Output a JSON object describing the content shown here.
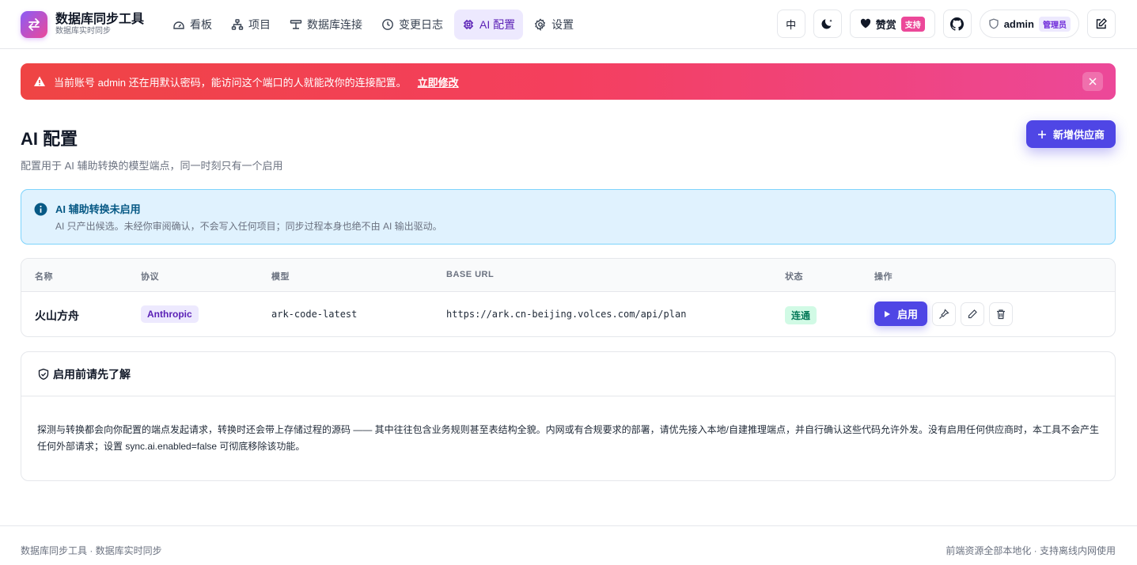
{
  "brand": {
    "title": "数据库同步工具",
    "subtitle": "数据库实时同步"
  },
  "nav": [
    {
      "label": "看板",
      "icon": "dashboard-icon"
    },
    {
      "label": "项目",
      "icon": "project-tree-icon"
    },
    {
      "label": "数据库连接",
      "icon": "connection-icon"
    },
    {
      "label": "变更日志",
      "icon": "clock-icon"
    },
    {
      "label": "AI 配置",
      "icon": "chip-icon",
      "active": true
    },
    {
      "label": "设置",
      "icon": "gear-icon"
    }
  ],
  "header": {
    "lang": "中",
    "like_label": "赞赏",
    "like_badge": "支持",
    "user_name": "admin",
    "user_role": "管理员"
  },
  "alert": {
    "message": "当前账号 admin 还在用默认密码，能访问这个端口的人就能改你的连接配置。",
    "link": "立即修改"
  },
  "page": {
    "title": "AI 配置",
    "description": "配置用于 AI 辅助转换的模型端点，同一时刻只有一个启用",
    "add_button": "新增供应商"
  },
  "info": {
    "title": "AI 辅助转换未启用",
    "text": "AI 只产出候选。未经你审阅确认，不会写入任何项目；同步过程本身也绝不由 AI 输出驱动。"
  },
  "table": {
    "columns": [
      "名称",
      "协议",
      "模型",
      "BASE URL",
      "状态",
      "操作"
    ],
    "rows": [
      {
        "name": "火山方舟",
        "protocol": "Anthropic",
        "model": "ark-code-latest",
        "base_url": "https://ark.cn-beijing.volces.com/api/plan",
        "status": "连通",
        "enable_label": "启用"
      }
    ]
  },
  "notice": {
    "title": "启用前请先了解",
    "body": "探测与转换都会向你配置的端点发起请求，转换时还会带上存储过程的源码 —— 其中往往包含业务规则甚至表结构全貌。内网或有合规要求的部署，请优先接入本地/自建推理端点，并自行确认这些代码允许外发。没有启用任何供应商时，本工具不会产生任何外部请求；设置 sync.ai.enabled=false 可彻底移除该功能。"
  },
  "footer": {
    "left": "数据库同步工具 · 数据库实时同步",
    "right": "前端资源全部本地化 · 支持离线内网使用"
  },
  "colors": {
    "primary": "#4f46e5",
    "alert_start": "#ef4444",
    "alert_end": "#ec4899",
    "info_bg": "#e0f2fe",
    "status_ok": "#047857"
  }
}
